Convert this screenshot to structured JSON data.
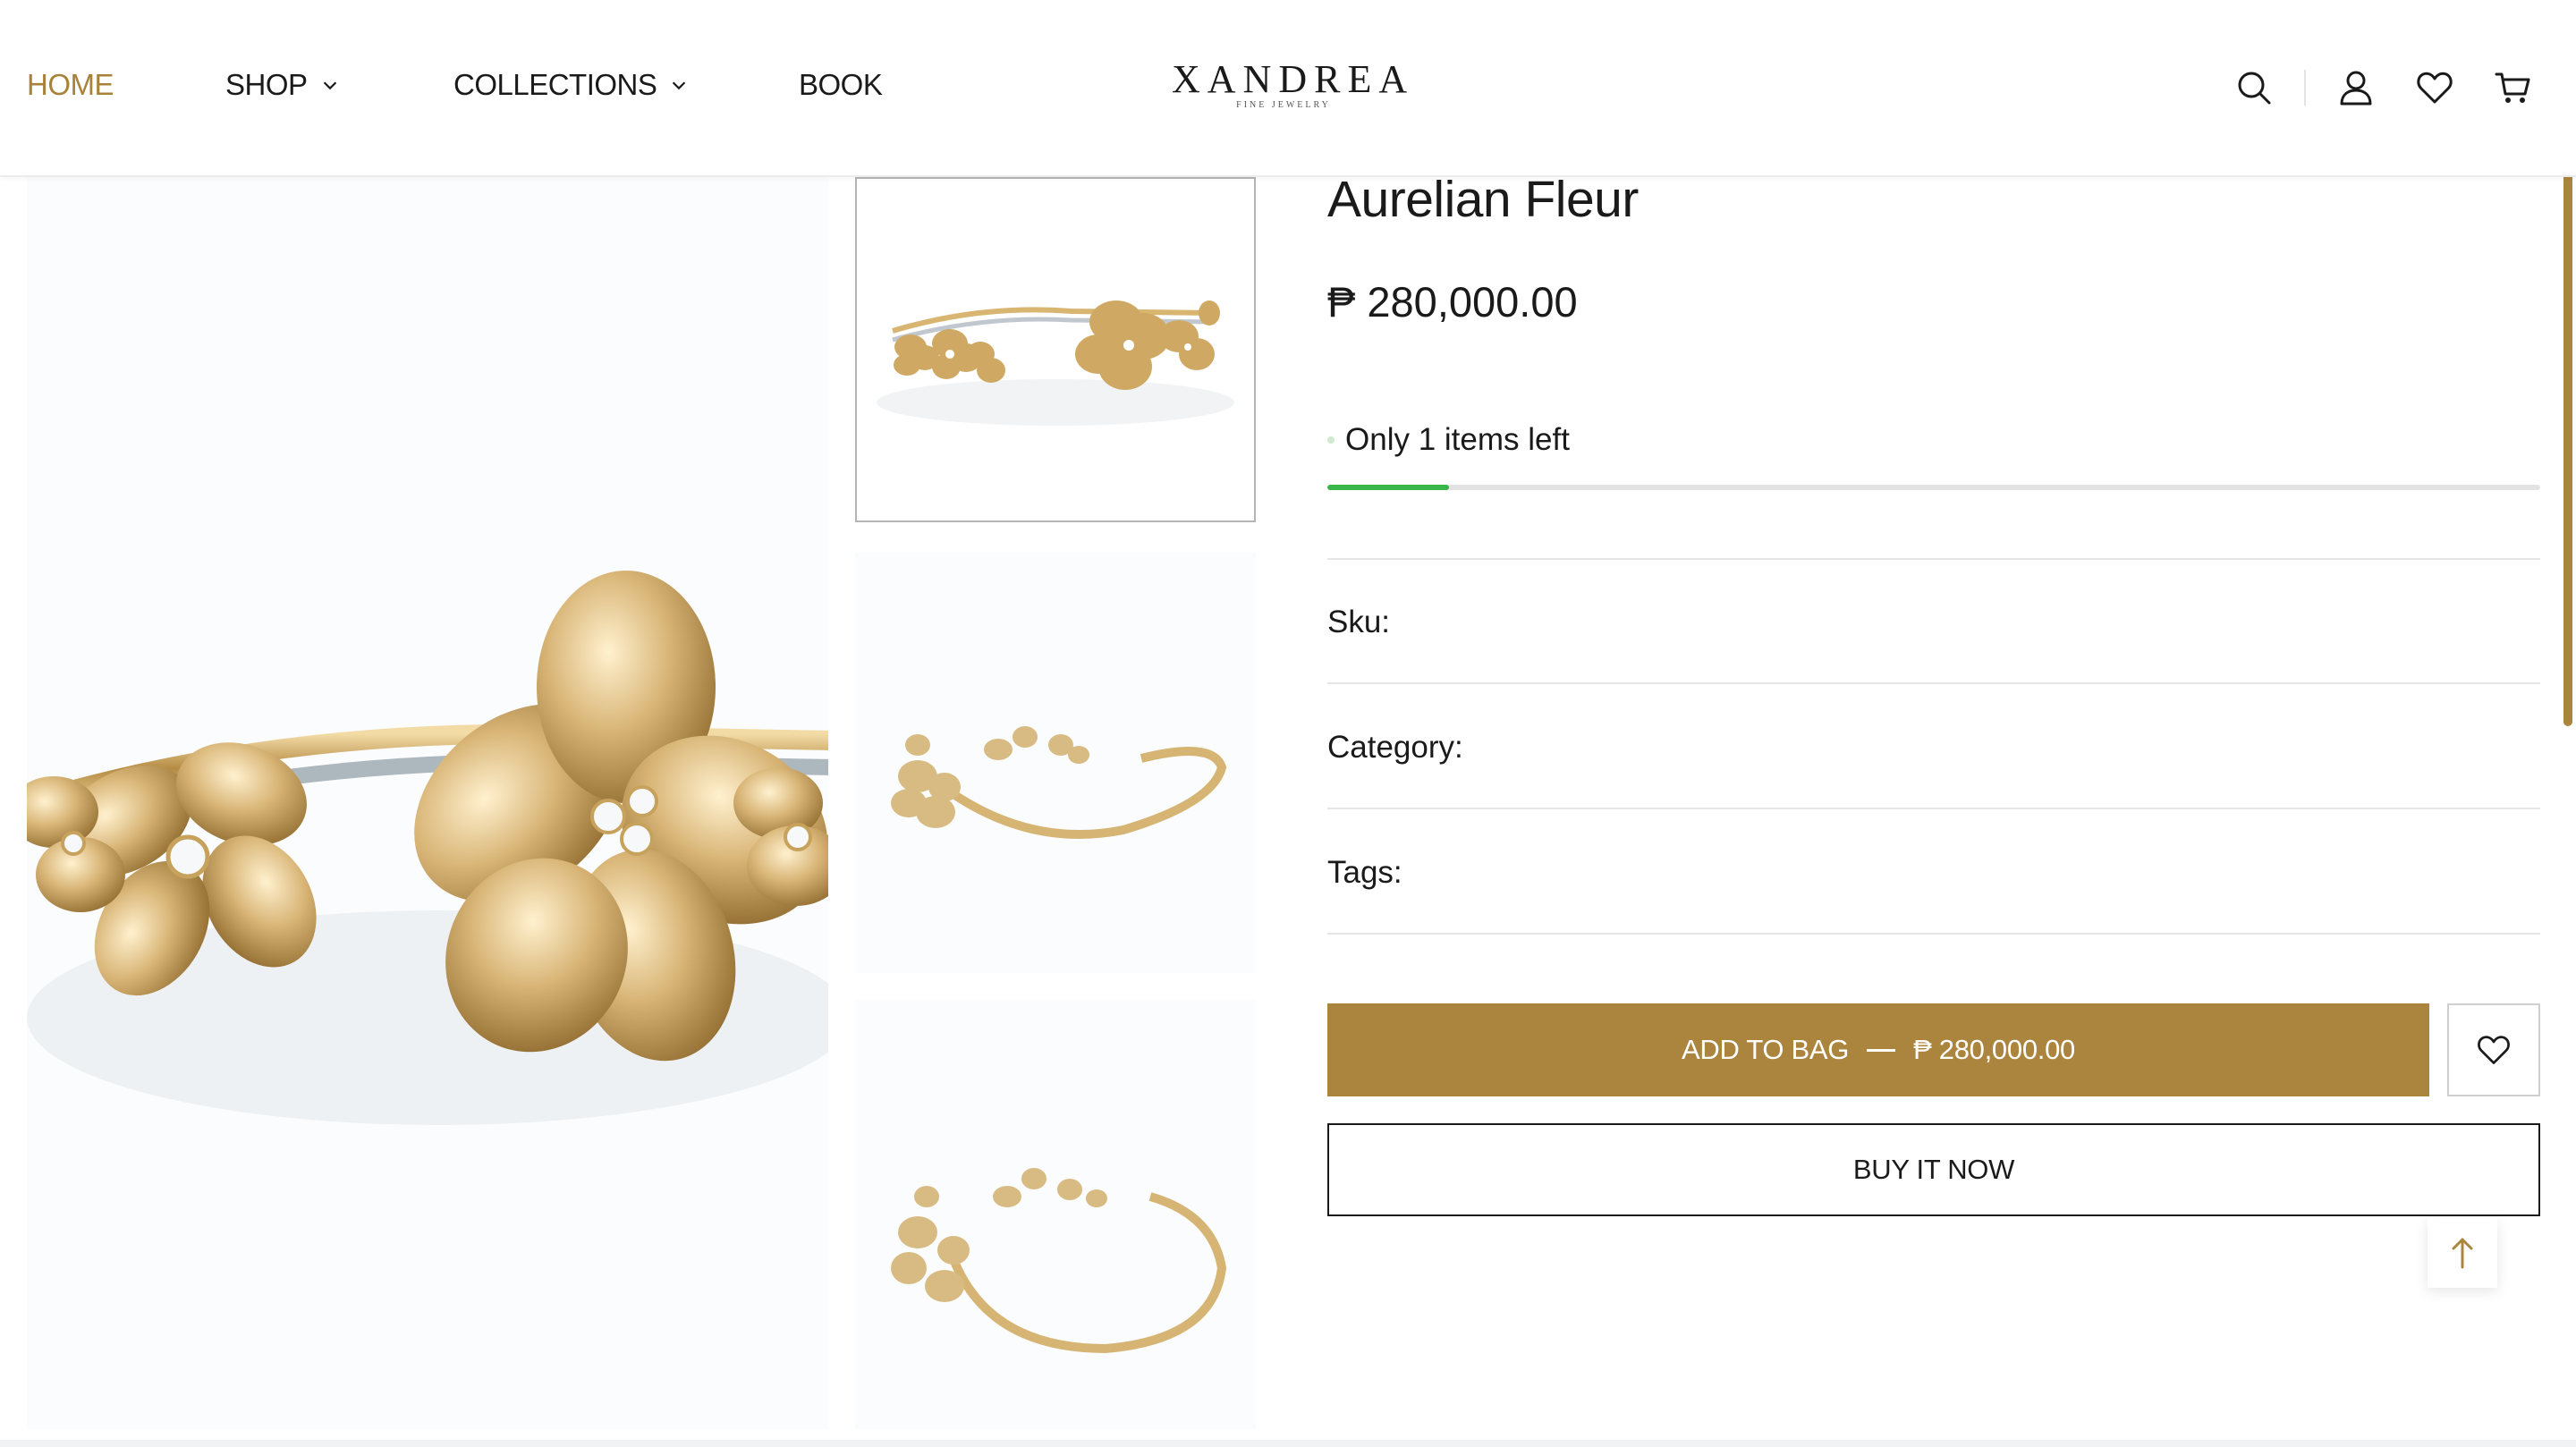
{
  "header": {
    "nav": [
      {
        "label": "HOME",
        "active": true
      },
      {
        "label": "SHOP",
        "dropdown": true
      },
      {
        "label": "COLLECTIONS",
        "dropdown": true
      },
      {
        "label": "BOOK",
        "dropdown": false
      }
    ],
    "logo": {
      "main": "XANDREA",
      "sub": "FINE JEWELRY"
    },
    "icons": [
      "search-icon",
      "account-icon",
      "wishlist-icon",
      "cart-icon"
    ]
  },
  "product": {
    "title": "Aurelian Fleur",
    "price": "₱ 280,000.00",
    "stock_text": "Only 1 items left",
    "stock_fraction": 0.1,
    "sku_label": "Sku:",
    "category_label": "Category:",
    "tags_label": "Tags:",
    "add_to_bag_label": "ADD TO BAG",
    "add_to_bag_price": "₱ 280,000.00",
    "buy_now_label": "BUY IT NOW"
  },
  "colors": {
    "accent": "#ab853e",
    "nav_active": "#a8813a",
    "stock_fill": "#3ab54a"
  }
}
